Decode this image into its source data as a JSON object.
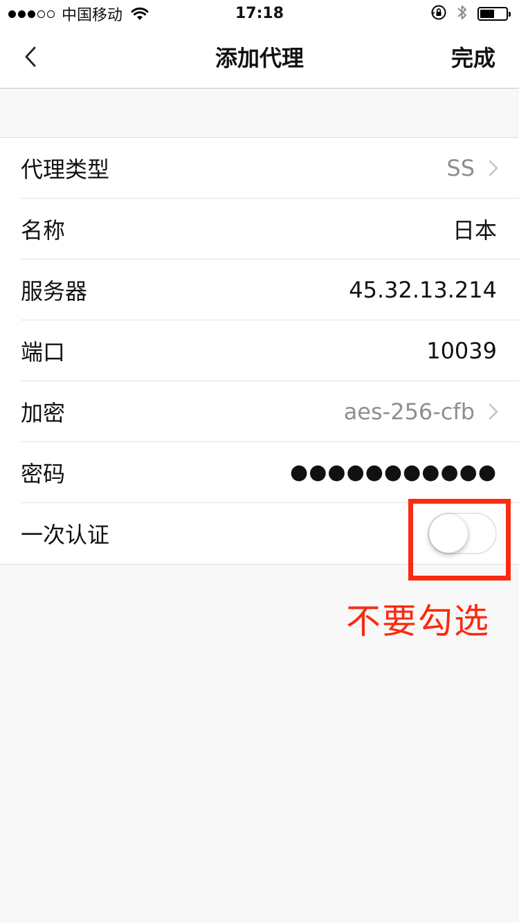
{
  "status_bar": {
    "signal": {
      "filled": 3,
      "total": 5
    },
    "carrier": "中国移动",
    "time": "17:18",
    "battery_level": 0.55,
    "icons": [
      "wifi-icon",
      "orientation-lock-icon",
      "bluetooth-icon",
      "battery-icon"
    ]
  },
  "nav": {
    "back_icon": "chevron-left-icon",
    "title": "添加代理",
    "done_label": "完成"
  },
  "form": {
    "rows": [
      {
        "label": "代理类型",
        "value": "SS",
        "has_chevron": true
      },
      {
        "label": "名称",
        "value": "日本",
        "has_chevron": false
      },
      {
        "label": "服务器",
        "value": "45.32.13.214",
        "has_chevron": false
      },
      {
        "label": "端口",
        "value": "10039",
        "has_chevron": false
      },
      {
        "label": "加密",
        "value": "aes-256-cfb",
        "has_chevron": true
      },
      {
        "label": "密码",
        "value": "●●●●●●●●●●●",
        "has_chevron": false
      },
      {
        "label": "一次认证",
        "toggle_on": false
      }
    ]
  },
  "annotation": {
    "text": "不要勾选",
    "color": "#fb2a10"
  },
  "colors": {
    "background": "#f8f8f8",
    "muted_text": "#8e8e93",
    "annotation_red": "#fb2a10"
  }
}
